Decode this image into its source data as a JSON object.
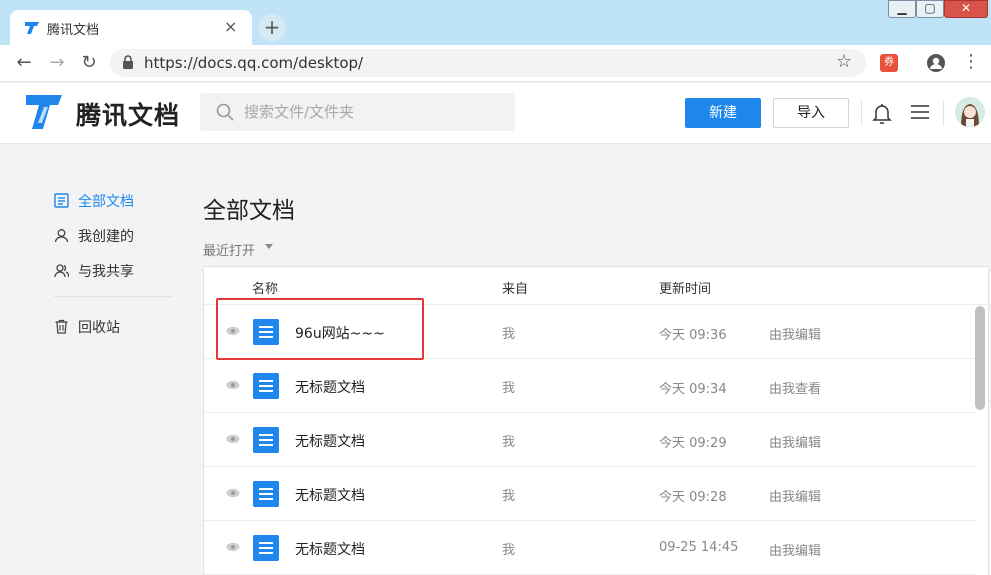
{
  "browser": {
    "tab_title": "腾讯文档",
    "tab_close": "×",
    "new_tab": "+",
    "url": "https://docs.qq.com/desktop/",
    "extension_badge": "券"
  },
  "header": {
    "logo_text": "腾讯文档",
    "search_placeholder": "搜索文件/文件夹",
    "new_button": "新建",
    "import_button": "导入"
  },
  "sidebar": {
    "items": [
      {
        "label": "全部文档",
        "icon": "doc-list-icon",
        "active": true
      },
      {
        "label": "我创建的",
        "icon": "user-icon",
        "active": false
      },
      {
        "label": "与我共享",
        "icon": "shared-users-icon",
        "active": false
      },
      {
        "label": "回收站",
        "icon": "trash-icon",
        "active": false
      }
    ]
  },
  "main": {
    "title": "全部文档",
    "sort_label": "最近打开",
    "columns": {
      "name": "名称",
      "from": "来自",
      "time": "更新时间"
    },
    "rows": [
      {
        "name": "96u网站~~~",
        "from": "我",
        "time": "今天 09:36",
        "action": "由我编辑"
      },
      {
        "name": "无标题文档",
        "from": "我",
        "time": "今天 09:34",
        "action": "由我查看"
      },
      {
        "name": "无标题文档",
        "from": "我",
        "time": "今天 09:29",
        "action": "由我编辑"
      },
      {
        "name": "无标题文档",
        "from": "我",
        "time": "今天 09:28",
        "action": "由我编辑"
      },
      {
        "name": "无标题文档",
        "from": "我",
        "time": "09-25 14:45",
        "action": "由我编辑"
      }
    ]
  },
  "colors": {
    "accent": "#1f87eb",
    "highlight": "#e53935"
  }
}
